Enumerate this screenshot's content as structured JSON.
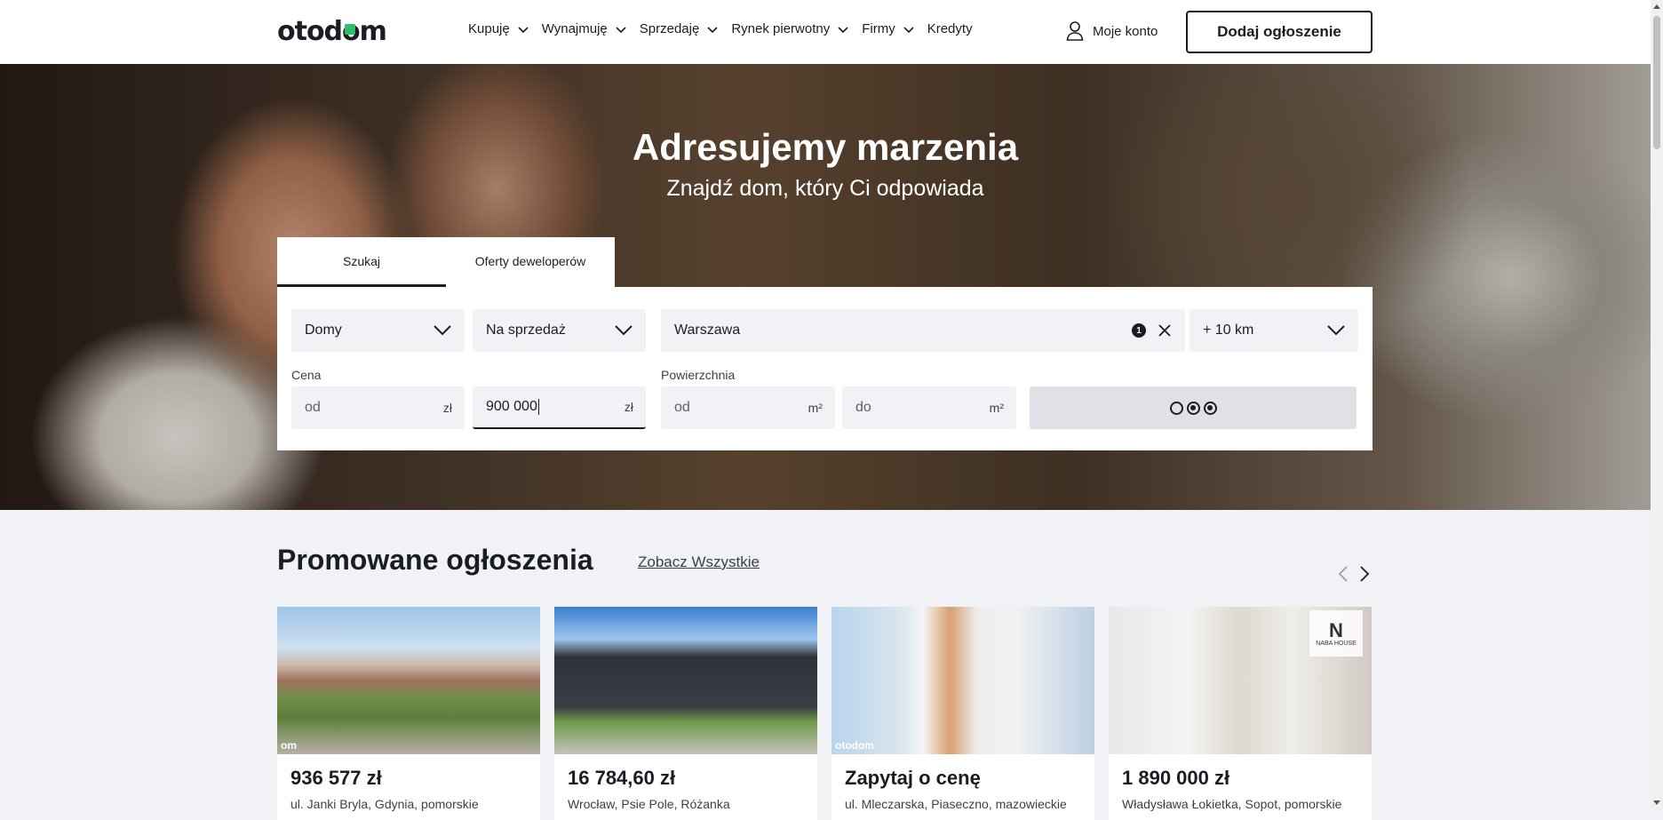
{
  "header": {
    "logo_prefix": "otod",
    "logo_accent": "o",
    "logo_suffix": "m",
    "nav": [
      {
        "label": "Kupuję",
        "has_dropdown": true
      },
      {
        "label": "Wynajmuję",
        "has_dropdown": true
      },
      {
        "label": "Sprzedaję",
        "has_dropdown": true
      },
      {
        "label": "Rynek pierwotny",
        "has_dropdown": true
      },
      {
        "label": "Firmy",
        "has_dropdown": true
      },
      {
        "label": "Kredyty",
        "has_dropdown": false
      }
    ],
    "account_label": "Moje konto",
    "add_listing_label": "Dodaj ogłoszenie"
  },
  "hero": {
    "title": "Adresujemy marzenia",
    "subtitle": "Znajdź dom, który Ci odpowiada"
  },
  "search": {
    "tabs": [
      {
        "label": "Szukaj",
        "active": true
      },
      {
        "label": "Oferty deweloperów",
        "active": false
      }
    ],
    "property_type": "Domy",
    "transaction_type": "Na sprzedaż",
    "location": "Warszawa",
    "location_count": "1",
    "distance": "+ 10 km",
    "price_label": "Cena",
    "price_from_placeholder": "od",
    "price_to_value": "900 000",
    "currency": "zł",
    "area_label": "Powierzchnia",
    "area_from_placeholder": "od",
    "area_to_placeholder": "do",
    "area_unit": "m²"
  },
  "promoted": {
    "title": "Promowane ogłoszenia",
    "see_all": "Zobacz Wszystkie",
    "cards": [
      {
        "price": "936 577 zł",
        "address": "ul. Janki Bryla, Gdynia, pomorskie",
        "watermark": "om"
      },
      {
        "price": "16 784,60 zł",
        "address": "Wrocław, Psie Pole, Różanka",
        "watermark": ""
      },
      {
        "price": "Zapytaj o cenę",
        "address": "ul. Mleczarska, Piaseczno, mazowieckie",
        "watermark": "otodom"
      },
      {
        "price": "1 890 000 zł",
        "address": "Władysława Łokietka, Sopot, pomorskie",
        "watermark": ""
      }
    ],
    "card4_brand": "NABA HOUSE"
  },
  "colors": {
    "brand_green": "#2fbd6b",
    "text_dark": "#1a1d24",
    "field_bg": "#f0f2f5"
  }
}
